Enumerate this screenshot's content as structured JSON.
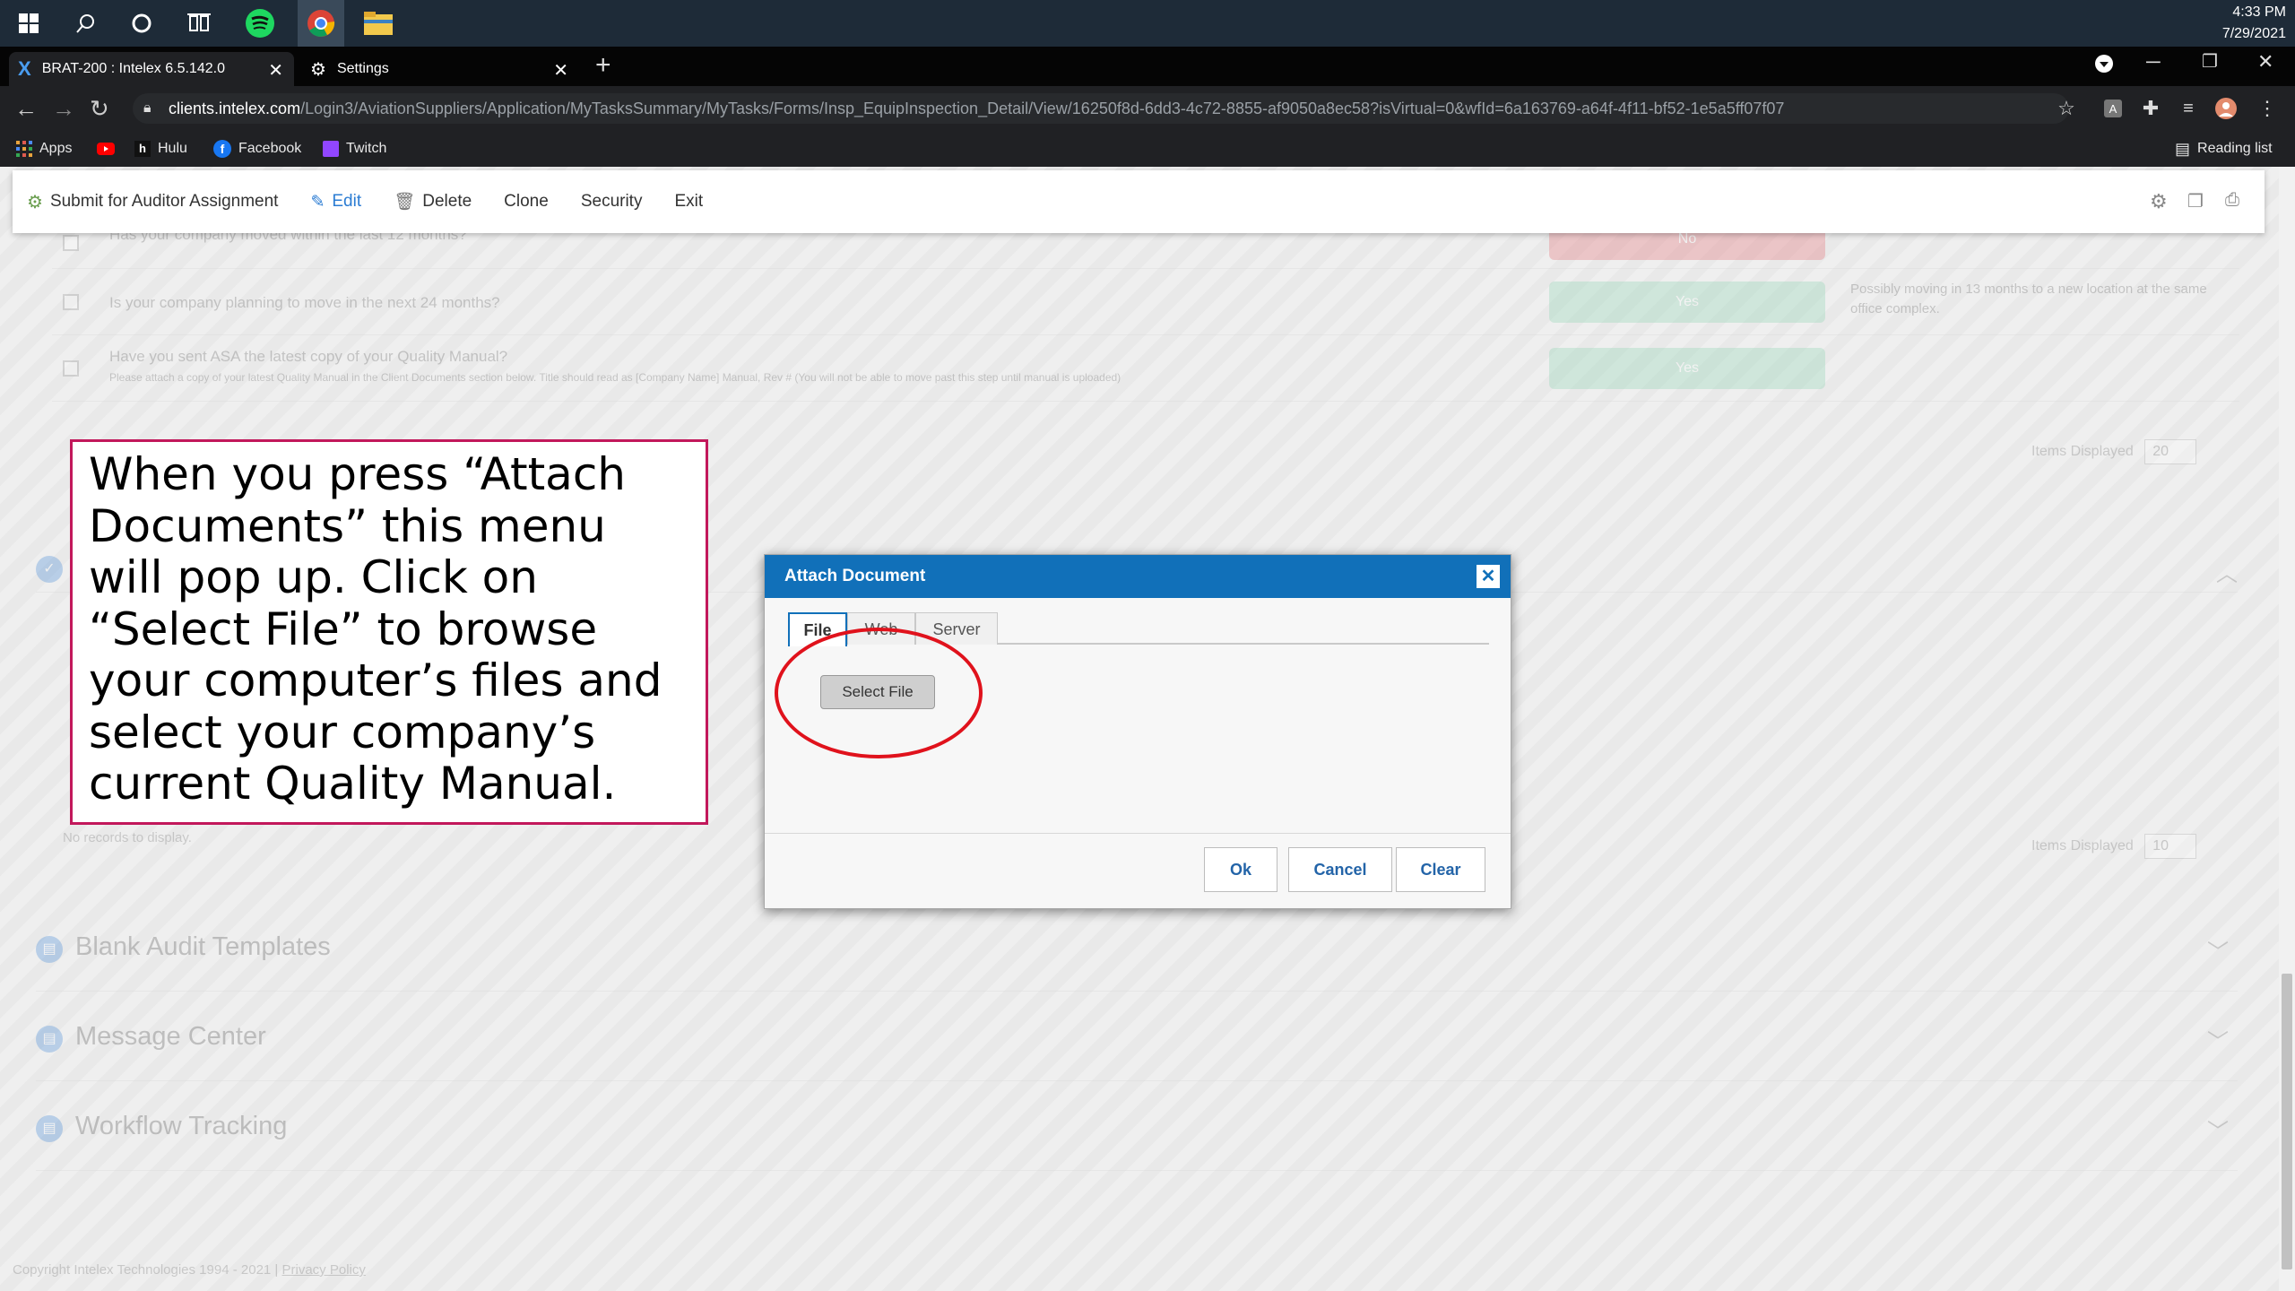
{
  "os": {
    "clock_time": "4:33 PM",
    "clock_date": "7/29/2021"
  },
  "browser": {
    "tabs": [
      {
        "title": "BRAT-200 : Intelex 6.5.142.0",
        "icon": "intelex-x-icon"
      },
      {
        "title": "Settings",
        "icon": "gear-icon"
      }
    ],
    "url_host": "clients.intelex.com",
    "url_path": "/Login3/AviationSuppliers/Application/MyTasksSummary/MyTasks/Forms/Insp_EquipInspection_Detail/View/16250f8d-6dd3-4c72-8855-af9050a8ec58?isVirtual=0&wfId=6a163769-a64f-4f11-bf52-1e5a5ff07f07",
    "bookmarks": [
      "Apps",
      "Hulu",
      "Facebook",
      "Twitch"
    ],
    "reading_list": "Reading list"
  },
  "toolbar": {
    "submit": "Submit for Auditor Assignment",
    "edit": "Edit",
    "delete": "Delete",
    "clone": "Clone",
    "security": "Security",
    "exit": "Exit"
  },
  "checklist": [
    {
      "question": "Has your company moved within the last 12 months?",
      "answer": "No"
    },
    {
      "question": "Is your company planning to move in the next 24 months?",
      "answer": "Yes",
      "note": "Possibly moving in 13 months to a new location at the same office complex."
    },
    {
      "question": "Have you sent ASA the latest copy of your Quality Manual?",
      "sub": "Please attach a copy of your latest Quality Manual in the Client Documents section below. Title should read as [Company Name] Manual, Rev # (You will not be able to move past this step until manual is uploaded)",
      "answer": "Yes"
    }
  ],
  "items_displayed_label": "Items Displayed",
  "items_displayed_1": "20",
  "items_displayed_2": "10",
  "no_records": "No records to display.",
  "sections": [
    "Blank Audit Templates",
    "Message Center",
    "Workflow Tracking"
  ],
  "footer": {
    "copyright": "Copyright Intelex Technologies 1994 - 2021 |",
    "privacy": "Privacy Policy"
  },
  "modal": {
    "title": "Attach Document",
    "tabs": [
      "File",
      "Web",
      "Server"
    ],
    "select_file": "Select File",
    "ok": "Ok",
    "cancel": "Cancel",
    "clear": "Clear"
  },
  "callout_text": "When you press “Attach Documents” this menu will pop up. Click on “Select File” to browse your computer’s files and select your company’s current Quality Manual.",
  "colors": {
    "accent": "#1170b9",
    "highlight_circle": "#e0121c",
    "callout_border": "#c2185b",
    "no_pill": "#e35b63",
    "yes_pill": "#7fcfa8"
  }
}
